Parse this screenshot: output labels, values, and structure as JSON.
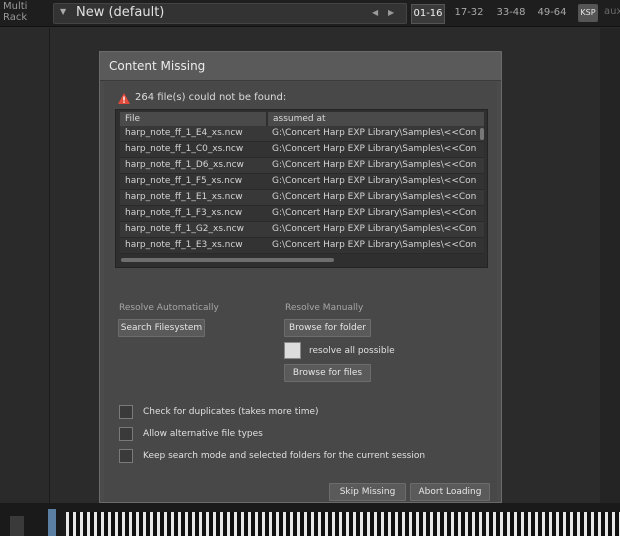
{
  "rack": {
    "title_line1": "Multi",
    "title_line2": "Rack",
    "preset_name": "New (default)",
    "tabs": [
      {
        "label": "01-16",
        "active": true
      },
      {
        "label": "17-32",
        "active": false
      },
      {
        "label": "33-48",
        "active": false
      },
      {
        "label": "49-64",
        "active": false
      }
    ],
    "ksp_label": "KSP",
    "aux_label": "aux"
  },
  "dialog": {
    "title": "Content Missing",
    "summary": "264 file(s) could not be found:",
    "table": {
      "columns": [
        "File",
        "assumed at"
      ],
      "rows": [
        {
          "file": "harp_note_ff_1_E4_xs.ncw",
          "path": "G:\\Concert Harp EXP Library\\Samples\\<<Con"
        },
        {
          "file": "harp_note_ff_1_C0_xs.ncw",
          "path": "G:\\Concert Harp EXP Library\\Samples\\<<Con"
        },
        {
          "file": "harp_note_ff_1_D6_xs.ncw",
          "path": "G:\\Concert Harp EXP Library\\Samples\\<<Con"
        },
        {
          "file": "harp_note_ff_1_F5_xs.ncw",
          "path": "G:\\Concert Harp EXP Library\\Samples\\<<Con"
        },
        {
          "file": "harp_note_ff_1_E1_xs.ncw",
          "path": "G:\\Concert Harp EXP Library\\Samples\\<<Con"
        },
        {
          "file": "harp_note_ff_1_F3_xs.ncw",
          "path": "G:\\Concert Harp EXP Library\\Samples\\<<Con"
        },
        {
          "file": "harp_note_ff_1_G2_xs.ncw",
          "path": "G:\\Concert Harp EXP Library\\Samples\\<<Con"
        },
        {
          "file": "harp_note_ff_1_E3_xs.ncw",
          "path": "G:\\Concert Harp EXP Library\\Samples\\<<Con"
        }
      ]
    },
    "resolve_auto": {
      "label": "Resolve Automatically",
      "search_button": "Search Filesystem"
    },
    "resolve_manual": {
      "label": "Resolve Manually",
      "browse_folder_button": "Browse for folder",
      "resolve_all_label": "resolve all possible",
      "browse_files_button": "Browse for files"
    },
    "options": {
      "duplicates": "Check for duplicates (takes more time)",
      "alt_types": "Allow alternative file types",
      "keep_mode": "Keep search mode and selected folders for the current session"
    },
    "skip_button": "Skip Missing",
    "abort_button": "Abort Loading"
  },
  "colors": {
    "warning": "#e04a3a",
    "accent": "#5b7fa3"
  },
  "icons": {
    "warning": "warning-triangle-icon",
    "menu": "chevron-down-icon",
    "prev": "triangle-left-icon",
    "next": "triangle-right-icon"
  }
}
